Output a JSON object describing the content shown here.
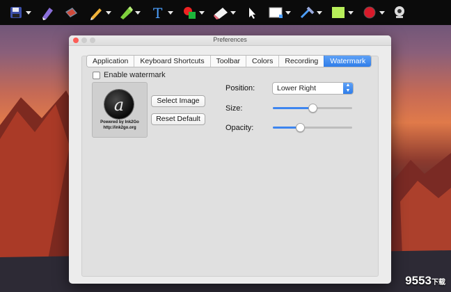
{
  "toolbar": {
    "items": [
      {
        "icon": "save-disk-icon",
        "has_dropdown": true
      },
      {
        "icon": "highlighter-pen-icon",
        "has_dropdown": false
      },
      {
        "icon": "book-icon",
        "has_dropdown": false
      },
      {
        "icon": "pencil-icon",
        "has_dropdown": true
      },
      {
        "icon": "marker-icon",
        "has_dropdown": true
      },
      {
        "icon": "text-tool-icon",
        "has_dropdown": true
      },
      {
        "icon": "shapes-icon",
        "has_dropdown": true
      },
      {
        "icon": "eraser-icon",
        "has_dropdown": true
      },
      {
        "icon": "pointer-arrow-icon",
        "has_dropdown": false
      },
      {
        "icon": "color-swatch-icon",
        "has_dropdown": true
      },
      {
        "icon": "line-width-icon",
        "has_dropdown": true
      },
      {
        "icon": "highlight-box-icon",
        "has_dropdown": true
      },
      {
        "icon": "record-icon",
        "has_dropdown": true
      },
      {
        "icon": "webcam-icon",
        "has_dropdown": false
      }
    ]
  },
  "window": {
    "title": "Preferences",
    "tabs": [
      "Application",
      "Keyboard Shortcuts",
      "Toolbar",
      "Colors",
      "Recording",
      "Watermark"
    ],
    "active_tab": "Watermark"
  },
  "watermark": {
    "enable_label": "Enable watermark",
    "enabled": false,
    "preview_line1": "Powered by Ink2Go",
    "preview_line2": "http://ink2go.org",
    "preview_glyph": "a",
    "select_image_label": "Select Image",
    "reset_default_label": "Reset Default",
    "position_label": "Position:",
    "position_value": "Lower Right",
    "size_label": "Size:",
    "size_level": 0.5,
    "opacity_label": "Opacity:",
    "opacity_level": 0.34
  },
  "overlay_watermark": {
    "main": "9553",
    "sub": "下载"
  },
  "colors": {
    "accent": "#3d85ef",
    "close": "#fc5d57",
    "minimize": "#cdcdcd",
    "zoom": "#cdcdcd"
  }
}
